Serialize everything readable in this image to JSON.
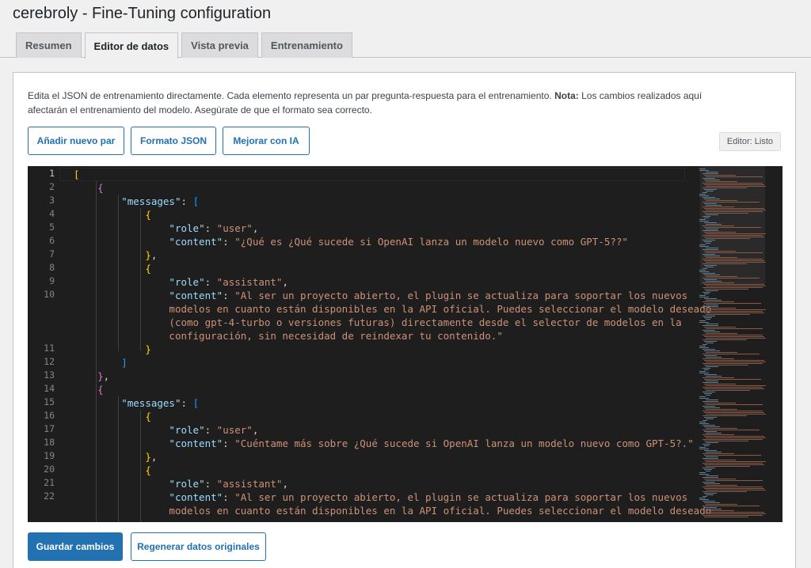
{
  "page": {
    "title": "cerebroly - Fine-Tuning configuration"
  },
  "tabs": [
    {
      "label": "Resumen"
    },
    {
      "label": "Editor de datos"
    },
    {
      "label": "Vista previa"
    },
    {
      "label": "Entrenamiento"
    }
  ],
  "description": {
    "text1": "Edita el JSON de entrenamiento directamente. Cada elemento representa un par pregunta-respuesta para el entrenamiento.",
    "note_label": "Nota:",
    "text2": "Los cambios realizados aquí afectarán el entrenamiento del modelo. Asegúrate de que el formato sea correcto."
  },
  "toolbar": {
    "add_pair": "Añadir nuevo par",
    "format_json": "Formato JSON",
    "improve_ai": "Mejorar con IA",
    "status": "Editor: Listo"
  },
  "editor": {
    "line_numbers": [
      "1",
      "2",
      "3",
      "4",
      "5",
      "6",
      "7",
      "8",
      "9",
      "10",
      "11",
      "12",
      "13",
      "14",
      "15",
      "16",
      "17",
      "18",
      "19",
      "20",
      "21",
      "22"
    ],
    "q1": "¿Qué es ¿Qué sucede si OpenAI lanza un modelo nuevo como GPT-5??",
    "a1_l1": "Al ser un proyecto abierto, el plugin se actualiza para soportar los nuevos",
    "a1_l2": "modelos en cuanto están disponibles en la API oficial. Puedes seleccionar el modelo deseado",
    "a1_l3": "(como gpt-4-turbo o versiones futuras) directamente desde el selector de modelos en la",
    "a1_l4": "configuración, sin necesidad de reindexar tu contenido.",
    "q2": "Cuéntame más sobre ¿Qué sucede si OpenAI lanza un modelo nuevo como GPT-5?.",
    "a2_l1": "Al ser un proyecto abierto, el plugin se actualiza para soportar los nuevos",
    "a2_l2": "modelos en cuanto están disponibles en la API oficial. Puedes seleccionar el modelo deseado",
    "key_messages": "messages",
    "key_role": "role",
    "key_content": "content",
    "val_user": "user",
    "val_assistant": "assistant"
  },
  "footer": {
    "save": "Guardar cambios",
    "regenerate": "Regenerar datos originales"
  },
  "colors": {
    "accent": "#2271b1",
    "editor_bg": "#1e1e1e",
    "json_key": "#9cdcfe",
    "json_string": "#ce9178"
  }
}
